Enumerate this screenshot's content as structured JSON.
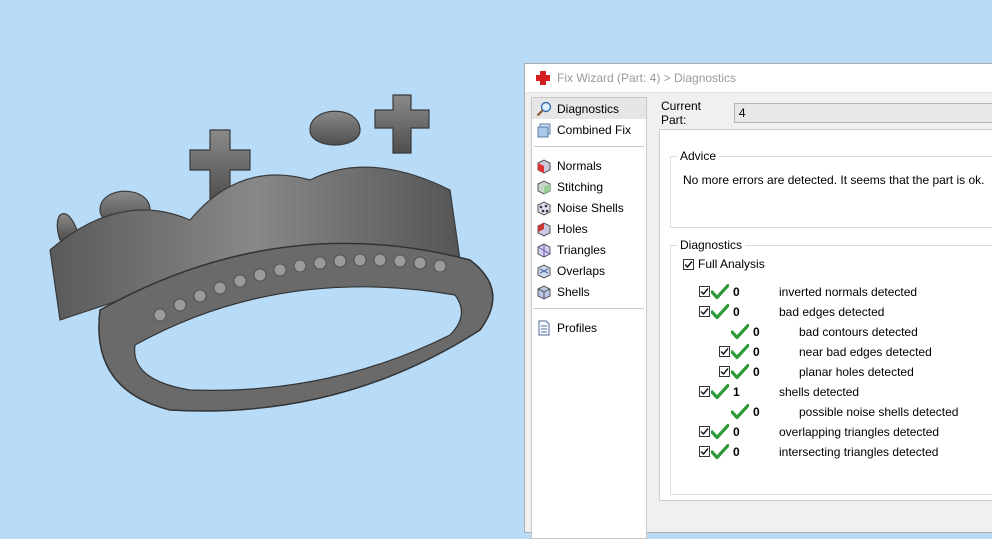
{
  "window": {
    "title": "Fix Wizard (Part: 4) > Diagnostics"
  },
  "sidebar": {
    "items": [
      {
        "label": "Diagnostics",
        "icon": "diagnostics-icon",
        "selected": true
      },
      {
        "label": "Combined Fix",
        "icon": "combined-fix-icon"
      },
      {
        "label": "Normals",
        "icon": "normals-icon"
      },
      {
        "label": "Stitching",
        "icon": "stitching-icon"
      },
      {
        "label": "Noise Shells",
        "icon": "noise-shells-icon"
      },
      {
        "label": "Holes",
        "icon": "holes-icon"
      },
      {
        "label": "Triangles",
        "icon": "triangles-icon"
      },
      {
        "label": "Overlaps",
        "icon": "overlaps-icon"
      },
      {
        "label": "Shells",
        "icon": "shells-icon"
      },
      {
        "label": "Profiles",
        "icon": "profiles-icon"
      }
    ]
  },
  "current_part": {
    "label": "Current Part:",
    "value": "4"
  },
  "advice": {
    "legend": "Advice",
    "text": "No more errors are detected. It seems that the part is ok."
  },
  "diagnostics": {
    "legend": "Diagnostics",
    "full_analysis": {
      "label": "Full Analysis",
      "checked": true
    },
    "rows": [
      {
        "count": "0",
        "label": "inverted normals detected",
        "checked": true
      },
      {
        "count": "0",
        "label": "bad edges detected",
        "checked": true
      },
      {
        "count": "0",
        "label": "bad contours detected"
      },
      {
        "count": "0",
        "label": "near bad edges detected",
        "checked": true
      },
      {
        "count": "0",
        "label": "planar holes detected",
        "checked": true
      },
      {
        "count": "1",
        "label": "shells detected",
        "checked": true
      },
      {
        "count": "0",
        "label": "possible noise shells detected"
      },
      {
        "count": "0",
        "label": "overlapping triangles detected",
        "checked": true
      },
      {
        "count": "0",
        "label": "intersecting triangles detected",
        "checked": true
      }
    ]
  },
  "colors": {
    "viewport_bg": "#b8dcf8",
    "model_gray": "#6f6f6f",
    "ok_green": "#2e9a3a",
    "app_icon_red": "#d42020"
  }
}
